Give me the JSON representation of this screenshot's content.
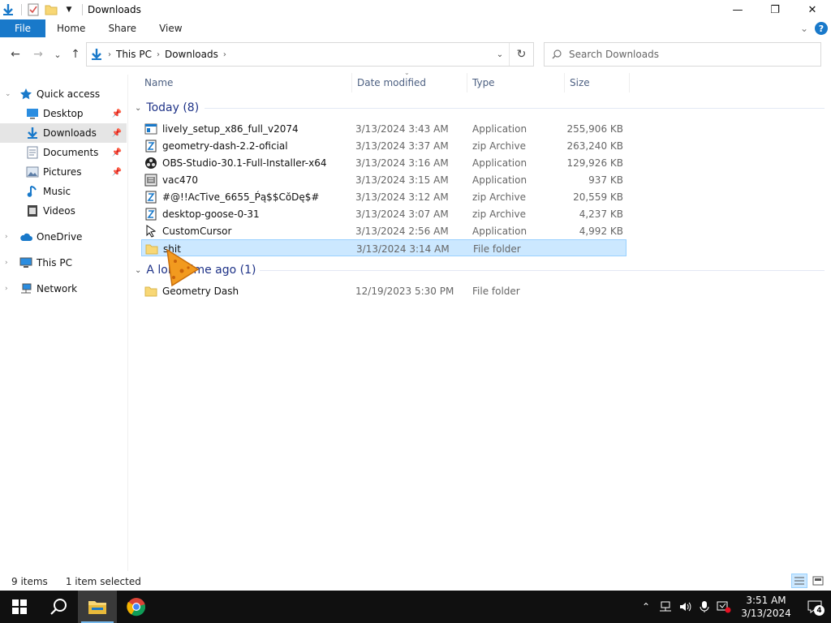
{
  "window": {
    "title": "Downloads",
    "minimize": "—",
    "restore": "❐",
    "close": "✕"
  },
  "ribbon": {
    "file": "File",
    "tabs": [
      "Home",
      "Share",
      "View"
    ],
    "expand": "⌄",
    "help": "?"
  },
  "nav": {
    "back": "←",
    "forward": "→",
    "recent": "⌄",
    "up": "↑"
  },
  "address": {
    "crumbs": [
      "This PC",
      "Downloads"
    ],
    "refresh": "↻"
  },
  "search": {
    "placeholder": "Search Downloads"
  },
  "sidebar": {
    "items": [
      {
        "label": "Quick access",
        "icon": "star-icon",
        "pinned": false
      },
      {
        "label": "Desktop",
        "icon": "desktop-icon",
        "pinned": true
      },
      {
        "label": "Downloads",
        "icon": "download-icon",
        "pinned": true
      },
      {
        "label": "Documents",
        "icon": "documents-icon",
        "pinned": true
      },
      {
        "label": "Pictures",
        "icon": "pictures-icon",
        "pinned": true
      },
      {
        "label": "Music",
        "icon": "music-icon",
        "pinned": false
      },
      {
        "label": "Videos",
        "icon": "videos-icon",
        "pinned": false
      },
      {
        "label": "OneDrive",
        "icon": "cloud-icon",
        "pinned": false
      },
      {
        "label": "This PC",
        "icon": "computer-icon",
        "pinned": false
      },
      {
        "label": "Network",
        "icon": "network-icon",
        "pinned": false
      }
    ]
  },
  "columns": {
    "name": "Name",
    "date": "Date modified",
    "type": "Type",
    "size": "Size"
  },
  "groups": [
    {
      "label": "Today (8)",
      "rows": [
        {
          "name": "lively_setup_x86_full_v2074",
          "date": "3/13/2024 3:43 AM",
          "type": "Application",
          "size": "255,906 KB",
          "icon": "installer-icon"
        },
        {
          "name": "geometry-dash-2.2-oficial",
          "date": "3/13/2024 3:37 AM",
          "type": "zip Archive",
          "size": "263,240 KB",
          "icon": "zip-icon"
        },
        {
          "name": "OBS-Studio-30.1-Full-Installer-x64",
          "date": "3/13/2024 3:16 AM",
          "type": "Application",
          "size": "129,926 KB",
          "icon": "obs-icon"
        },
        {
          "name": "vac470",
          "date": "3/13/2024 3:15 AM",
          "type": "Application",
          "size": "937 KB",
          "icon": "app-icon"
        },
        {
          "name": "#@!!AcTive_6655_Ṕą$$CŏDę$#",
          "date": "3/13/2024 3:12 AM",
          "type": "zip Archive",
          "size": "20,559 KB",
          "icon": "zip-icon"
        },
        {
          "name": "desktop-goose-0-31",
          "date": "3/13/2024 3:07 AM",
          "type": "zip Archive",
          "size": "4,237 KB",
          "icon": "zip-icon"
        },
        {
          "name": "CustomCursor",
          "date": "3/13/2024 2:56 AM",
          "type": "Application",
          "size": "4,992 KB",
          "icon": "cursor-app-icon"
        },
        {
          "name": "shit",
          "date": "3/13/2024 3:14 AM",
          "type": "File folder",
          "size": "",
          "icon": "folder-icon",
          "selected": true
        }
      ]
    },
    {
      "label": "A long time ago (1)",
      "rows": [
        {
          "name": "Geometry Dash",
          "date": "12/19/2023 5:30 PM",
          "type": "File folder",
          "size": "",
          "icon": "folder-icon"
        }
      ]
    }
  ],
  "status": {
    "count": "9 items",
    "selection": "1 item selected"
  },
  "taskbar": {
    "time": "3:51 AM",
    "date": "3/13/2024",
    "notifications": "4"
  },
  "colors": {
    "accent": "#1979ca",
    "selection": "#cce8ff",
    "folder": "#f8d775",
    "group_text": "#1e3287"
  }
}
